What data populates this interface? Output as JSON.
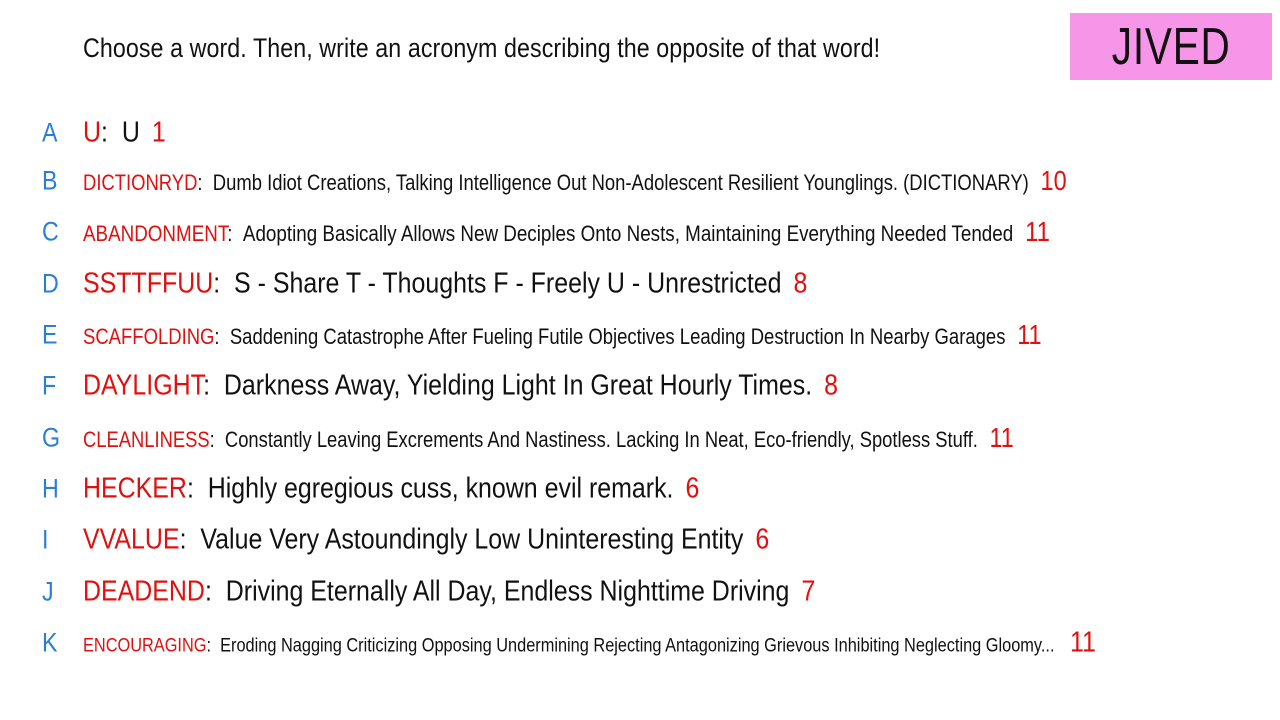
{
  "prompt": "Choose a word. Then, write an acronym describing the opposite of that word!",
  "logo": "JIVED",
  "entries": [
    {
      "letter": "A",
      "word": "U",
      "separator": ":",
      "text": "U",
      "score": "1"
    },
    {
      "letter": "B",
      "word": "DICTIONRYD",
      "separator": ":",
      "text": "Dumb Idiot Creations, Talking Intelligence Out Non-Adolescent Resilient Younglings. (DICTIONARY)",
      "score": "10"
    },
    {
      "letter": "C",
      "word": "ABANDONMENT",
      "separator": ":",
      "text": "Adopting Basically Allows New Deciples Onto Nests, Maintaining Everything Needed Tended",
      "score": "11"
    },
    {
      "letter": "D",
      "word": "SSTTFFUU",
      "separator": ":",
      "text": "S - Share T - Thoughts F - Freely U - Unrestricted",
      "score": "8"
    },
    {
      "letter": "E",
      "word": "SCAFFOLDING",
      "separator": ":",
      "text": "Saddening Catastrophe After Fueling Futile Objectives Leading Destruction In Nearby Garages",
      "score": "11"
    },
    {
      "letter": "F",
      "word": "DAYLIGHT",
      "separator": ":",
      "text": "Darkness Away, Yielding Light In Great Hourly Times.",
      "score": "8"
    },
    {
      "letter": "G",
      "word": "CLEANLINESS",
      "separator": ":",
      "text": "Constantly Leaving Excrements And Nastiness. Lacking In Neat, Eco-friendly, Spotless Stuff.",
      "score": "11"
    },
    {
      "letter": "H",
      "word": "HECKER",
      "separator": ":",
      "text": "Highly egregious cuss, known evil remark.",
      "score": "6"
    },
    {
      "letter": "I",
      "word": "VVALUE",
      "separator": ":",
      "text": "Value Very Astoundingly Low Uninteresting Entity",
      "score": "6"
    },
    {
      "letter": "J",
      "word": "DEADEND",
      "separator": ":",
      "text": "Driving Eternally All Day, Endless Nighttime Driving",
      "score": "7"
    },
    {
      "letter": "K",
      "word": "ENCOURAGING",
      "separator": ":",
      "text": "Eroding Nagging Criticizing Opposing Undermining Rejecting Antagonizing Grievous Inhibiting Neglecting Gloomy...",
      "score": "11"
    }
  ]
}
